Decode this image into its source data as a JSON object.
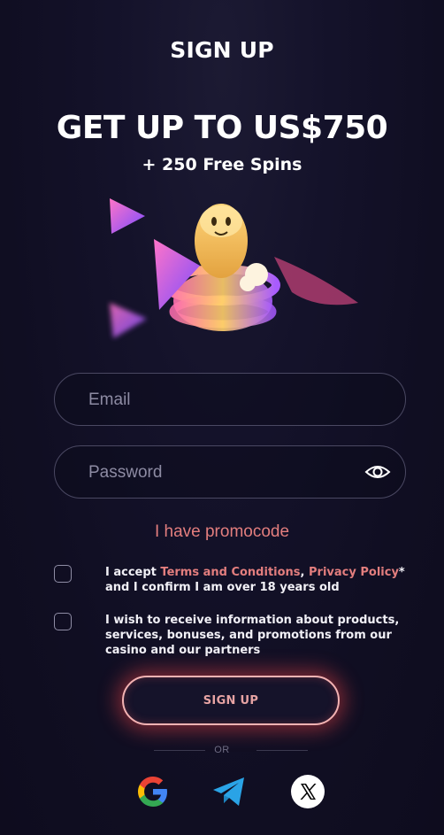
{
  "header": {
    "title": "SIGN UP"
  },
  "promo_banner": {
    "headline": "GET UP TO US$750",
    "subhead": "+ 250 Free Spins"
  },
  "form": {
    "email": {
      "placeholder": "Email",
      "value": ""
    },
    "password": {
      "placeholder": "Password",
      "value": ""
    },
    "promocode_link": "I have promocode",
    "terms": {
      "prefix": "I accept ",
      "terms_link": "Terms and Conditions",
      "separator": ", ",
      "privacy_link": "Privacy Policy",
      "suffix": "* and I confirm I am over 18 years old"
    },
    "marketing": {
      "text": "I wish to receive information about products, services, bonuses, and promotions from our casino and our partners"
    },
    "submit_label": "SIGN UP",
    "or_label": "OR"
  },
  "social": [
    {
      "icon": "google-icon"
    },
    {
      "icon": "telegram-icon"
    },
    {
      "icon": "x-icon"
    }
  ],
  "colors": {
    "accent": "#e37e7e",
    "background": "#14122a",
    "button_glow": "#ff4646"
  }
}
